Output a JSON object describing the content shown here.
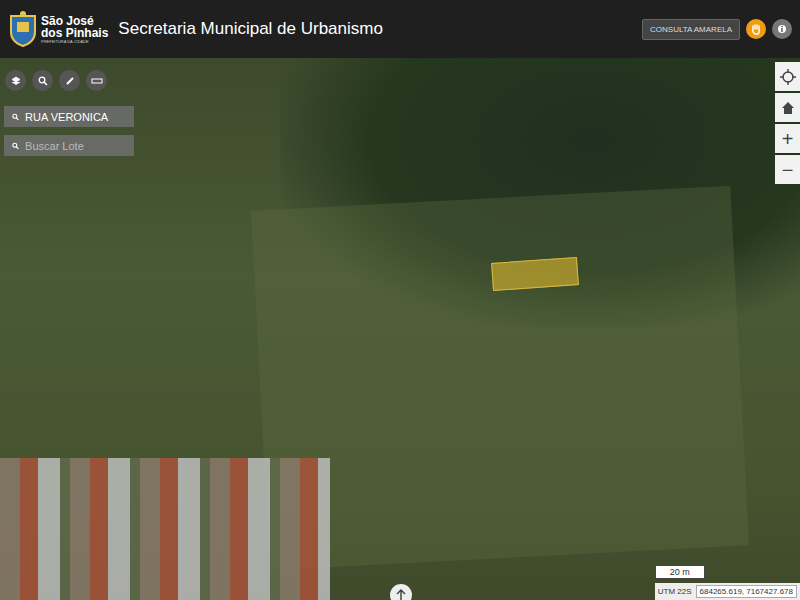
{
  "header": {
    "logo_line1": "São José",
    "logo_line2": "dos Pinhais",
    "logo_sub": "PREFEITURA DA CIDADE",
    "title": "Secretaria Municipal de Urbanismo",
    "consult_button": "CONSULTA AMARELA"
  },
  "toolbar": [
    {
      "tool": "layers"
    },
    {
      "tool": "search"
    },
    {
      "tool": "draw"
    },
    {
      "tool": "measure"
    }
  ],
  "search_fields": [
    {
      "value": "RUA VERONICA",
      "placeholder": ""
    },
    {
      "value": "",
      "placeholder": "Buscar Lote"
    }
  ],
  "map_controls": [
    {
      "kind": "locate",
      "label": ""
    },
    {
      "kind": "home",
      "label": ""
    },
    {
      "kind": "zoom",
      "label": "+"
    },
    {
      "kind": "zoom",
      "label": "−"
    }
  ],
  "selected_parcel": {
    "highlighted": true
  },
  "scale": "20 m",
  "coordinates": {
    "system": "UTM 22S",
    "value": "684265.619, 7167427.678"
  }
}
